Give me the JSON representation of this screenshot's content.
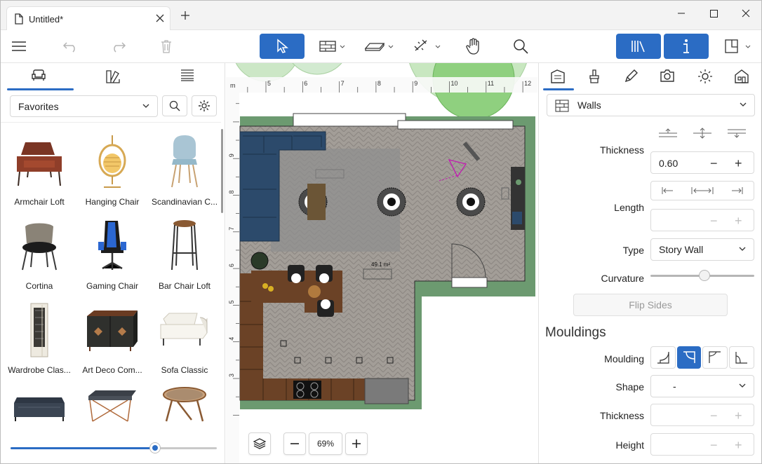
{
  "window": {
    "tab_title": "Untitled*"
  },
  "toolbar": {
    "icons": [
      "menu-icon",
      "undo-icon",
      "redo-icon",
      "trash-icon",
      "select-arrow-icon",
      "wall-icon",
      "floor-icon",
      "measure-icon",
      "pan-hand-icon",
      "search-icon",
      "library-icon",
      "info-icon",
      "layout-icon"
    ]
  },
  "left_panel": {
    "tabs": [
      "furniture-tab",
      "materials-tab",
      "list-tab"
    ],
    "category": "Favorites",
    "items": [
      {
        "label": "Armchair Loft"
      },
      {
        "label": "Hanging Chair"
      },
      {
        "label": "Scandinavian C..."
      },
      {
        "label": "Cortina"
      },
      {
        "label": "Gaming Chair"
      },
      {
        "label": "Bar Chair Loft"
      },
      {
        "label": "Wardrobe Clas..."
      },
      {
        "label": "Art Deco Com..."
      },
      {
        "label": "Sofa Classic"
      }
    ],
    "size_slider": 0.7
  },
  "canvas": {
    "ruler_unit": "m",
    "ruler_top": [
      "5",
      "6",
      "7",
      "8",
      "9",
      "10",
      "11",
      "12"
    ],
    "ruler_left": [
      "3",
      "4",
      "5",
      "6",
      "7",
      "8",
      "9"
    ],
    "area_label": "49.1 m²",
    "zoom": "69%"
  },
  "right_panel": {
    "object_type": "Walls",
    "thickness_label": "Thickness",
    "thickness_value": "0.60",
    "length_label": "Length",
    "type_label": "Type",
    "type_value": "Story Wall",
    "curvature_label": "Curvature",
    "curvature_value": 0.52,
    "flip_sides": "Flip Sides",
    "mouldings_title": "Mouldings",
    "moulding_label": "Moulding",
    "shape_label": "Shape",
    "shape_value": "-",
    "m_thickness_label": "Thickness",
    "height_label": "Height"
  },
  "colors": {
    "accent": "#2b6cc4",
    "wall_green": "#6c9a70"
  }
}
